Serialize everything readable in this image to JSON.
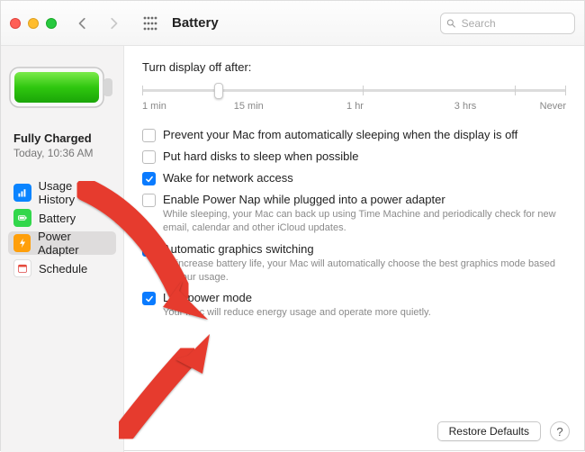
{
  "header": {
    "title": "Battery",
    "search_placeholder": "Search"
  },
  "status": {
    "line1": "Fully Charged",
    "line2": "Today, 10:36 AM"
  },
  "sidebar": {
    "items": [
      {
        "label": "Usage History"
      },
      {
        "label": "Battery"
      },
      {
        "label": "Power Adapter"
      },
      {
        "label": "Schedule"
      }
    ],
    "selected_index": 2
  },
  "slider": {
    "label": "Turn display off after:",
    "ticks": [
      "1 min",
      "15 min",
      "1 hr",
      "3 hrs",
      "Never"
    ],
    "value_index": 1
  },
  "options": [
    {
      "label": "Prevent your Mac from automatically sleeping when the display is off",
      "checked": false
    },
    {
      "label": "Put hard disks to sleep when possible",
      "checked": false
    },
    {
      "label": "Wake for network access",
      "checked": true
    },
    {
      "label": "Enable Power Nap while plugged into a power adapter",
      "checked": false,
      "sub": "While sleeping, your Mac can back up using Time Machine and periodically check for new email, calendar and other iCloud updates."
    },
    {
      "label": "Automatic graphics switching",
      "checked": true,
      "sub": "To increase battery life, your Mac will automatically choose the best graphics mode based on your usage."
    },
    {
      "label": "Low power mode",
      "checked": true,
      "sub": "Your Mac will reduce energy usage and operate more quietly."
    }
  ],
  "footer": {
    "restore_label": "Restore Defaults",
    "help_label": "?"
  }
}
